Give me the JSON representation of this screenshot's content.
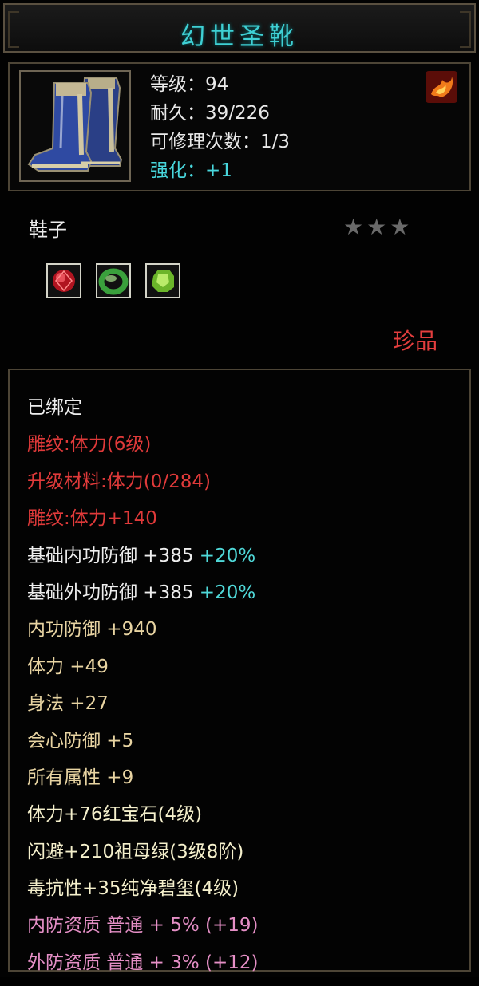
{
  "header": {
    "title": "幻世圣靴"
  },
  "item": {
    "icon": "blue-boots-icon",
    "level": "等级：94",
    "durability": "耐久：39/226",
    "repairs": "可修理次数：1/3",
    "enhance": "强化：+1",
    "element_icon": "fire-emblem-icon",
    "category": "鞋子",
    "stars": "★★★",
    "stars_filled": 0,
    "stars_total": 3,
    "gems": [
      "red-ruby-gem-icon",
      "green-jade-ring-icon",
      "green-emerald-gem-icon"
    ],
    "rarity": "珍品"
  },
  "details": {
    "bound": "已绑定",
    "engrave1": "雕纹:体力(6级)",
    "upgrade_material": "升级材料:体力(0/284)",
    "engrave2": "雕纹:体力+140",
    "base_inner_def": "基础内功防御 +385",
    "base_inner_def_pct": "+20%",
    "base_outer_def": "基础外功防御 +385",
    "base_outer_def_pct": "+20%",
    "inner_def": "内功防御 +940",
    "stamina": "体力 +49",
    "agility": "身法 +27",
    "crit_def": "会心防御 +5",
    "all_attr": "所有属性 +9",
    "gem1": "体力+76红宝石(4级)",
    "gem2": "闪避+210祖母绿(3级8阶)",
    "gem3": "毒抗性+35纯净碧玺(4级)",
    "inner_quality": "内防资质 普通 + 5% (+19)",
    "outer_quality": "外防资质 普通 + 3% (+12)"
  },
  "colors": {
    "title": "#3fd0d4",
    "enhance": "#48d6dc",
    "rarity": "#e33e3e",
    "engrave": "#e03a3a",
    "stat": "#e8d4a2",
    "quality": "#e58fc6",
    "percent": "#4fd8d8",
    "gem_line": "#f5f0cc"
  }
}
